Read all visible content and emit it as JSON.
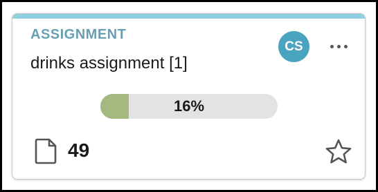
{
  "card": {
    "type_label": "ASSIGNMENT",
    "title": "drinks assignment [1]",
    "avatar_initials": "CS",
    "progress": {
      "percent": 16,
      "label": "16%"
    },
    "document_count": "49",
    "icons": {
      "more": "more-horizontal-icon",
      "document": "document-icon",
      "favorite": "star-outline-icon"
    },
    "colors": {
      "accent_bar": "#8fd0e0",
      "type_label": "#6a9fb3",
      "avatar": "#4aa3bf",
      "progress_fill": "#a3b97f",
      "progress_track": "#e3e3e3"
    }
  }
}
